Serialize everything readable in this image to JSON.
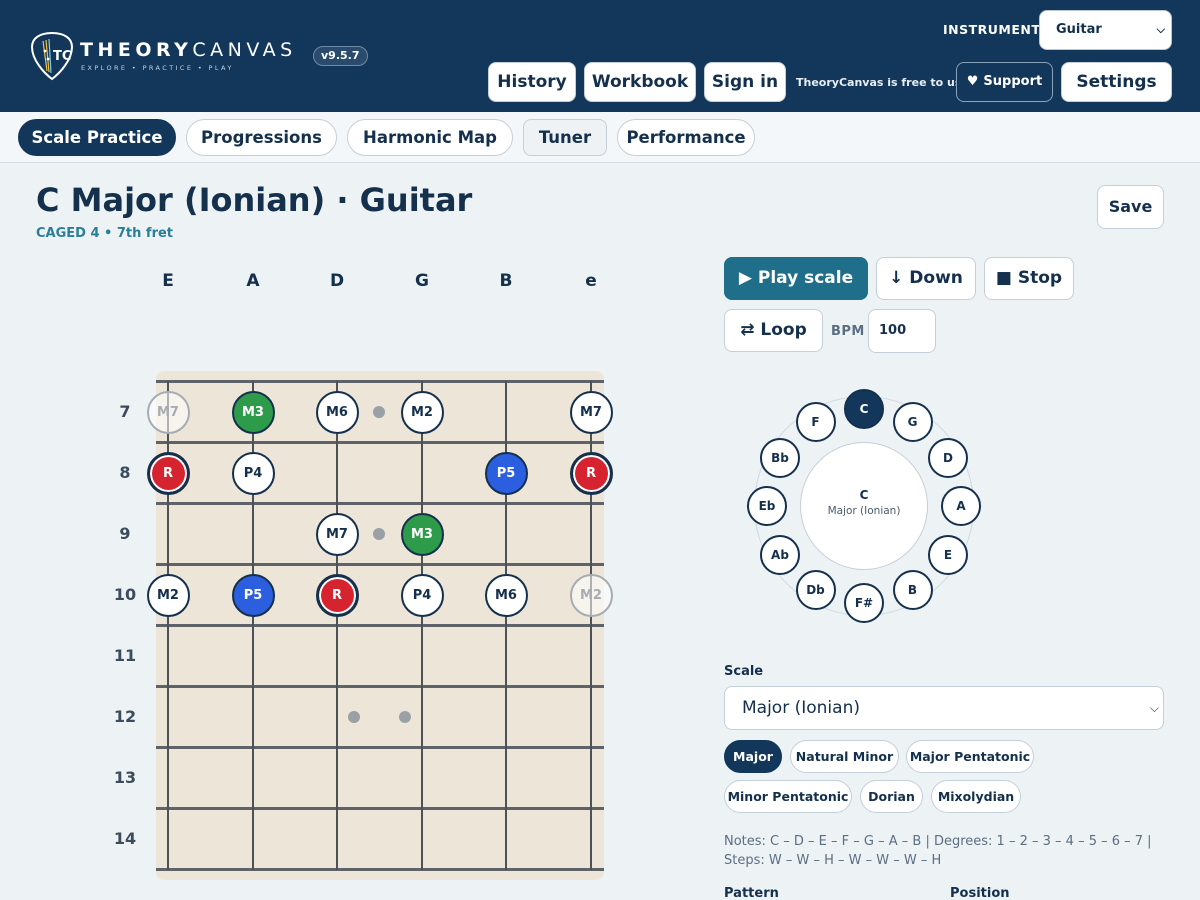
{
  "header": {
    "brand_bold": "THEORY",
    "brand_light": "CANVAS",
    "tagline": "EXPLORE • PRACTICE • PLAY",
    "logo_letters": "TC",
    "version": "v9.5.7",
    "instrument_label": "INSTRUMENT",
    "instrument_value": "Guitar",
    "nav": {
      "history": "History",
      "workbook": "Workbook",
      "sign_in": "Sign in"
    },
    "free_text": "TheoryCanvas is free to use.",
    "support": "Support",
    "settings": "Settings"
  },
  "tabs": [
    "Scale Practice",
    "Progressions",
    "Harmonic Map",
    "Tuner",
    "Performance"
  ],
  "active_tab": "Scale Practice",
  "page": {
    "title": "C Major (Ionian) · Guitar",
    "subtitle": "CAGED 4 • 7th fret",
    "save": "Save"
  },
  "fretboard": {
    "strings": [
      "E",
      "A",
      "D",
      "G",
      "B",
      "e"
    ],
    "frets": [
      "7",
      "8",
      "9",
      "10",
      "11",
      "12",
      "13",
      "14"
    ],
    "notes": [
      {
        "fret": 7,
        "string": 0,
        "label": "M7",
        "style": "faded"
      },
      {
        "fret": 7,
        "string": 1,
        "label": "M3",
        "style": "green"
      },
      {
        "fret": 7,
        "string": 2,
        "label": "M6",
        "style": "plain"
      },
      {
        "fret": 7,
        "string": 3,
        "label": "M2",
        "style": "plain"
      },
      {
        "fret": 7,
        "string": 5,
        "label": "M7",
        "style": "plain"
      },
      {
        "fret": 8,
        "string": 0,
        "label": "R",
        "style": "red"
      },
      {
        "fret": 8,
        "string": 1,
        "label": "P4",
        "style": "plain"
      },
      {
        "fret": 8,
        "string": 4,
        "label": "P5",
        "style": "blue"
      },
      {
        "fret": 8,
        "string": 5,
        "label": "R",
        "style": "red"
      },
      {
        "fret": 9,
        "string": 2,
        "label": "M7",
        "style": "plain"
      },
      {
        "fret": 9,
        "string": 3,
        "label": "M3",
        "style": "green"
      },
      {
        "fret": 10,
        "string": 0,
        "label": "M2",
        "style": "plain"
      },
      {
        "fret": 10,
        "string": 1,
        "label": "P5",
        "style": "blue"
      },
      {
        "fret": 10,
        "string": 2,
        "label": "R",
        "style": "red"
      },
      {
        "fret": 10,
        "string": 3,
        "label": "P4",
        "style": "plain"
      },
      {
        "fret": 10,
        "string": 4,
        "label": "M6",
        "style": "plain"
      },
      {
        "fret": 10,
        "string": 5,
        "label": "M2",
        "style": "faded"
      }
    ]
  },
  "controls": {
    "play": "Play scale",
    "down": "Down",
    "stop": "Stop",
    "loop": "Loop",
    "bpm_label": "BPM",
    "bpm_value": "100"
  },
  "circle": {
    "keys": [
      "C",
      "G",
      "D",
      "A",
      "E",
      "B",
      "F#",
      "Db",
      "Ab",
      "Eb",
      "Bb",
      "F"
    ],
    "active": "C",
    "center_key": "C",
    "center_mode": "Major (Ionian)"
  },
  "scale": {
    "label": "Scale",
    "selected": "Major (Ionian)",
    "chips": [
      "Major",
      "Natural Minor",
      "Major Pentatonic",
      "Minor Pentatonic",
      "Dorian",
      "Mixolydian"
    ],
    "active_chip": "Major",
    "notes_text": "Notes: C – D – E – F – G – A – B | Degrees: 1 – 2 – 3 – 4 – 5 – 6 – 7 | Steps: W – W – H – W – W – W – H",
    "pattern_label": "Pattern",
    "position_label": "Position"
  },
  "colors": {
    "navy": "#12375a",
    "teal": "#1f6f8b",
    "root_red": "#d5242f",
    "third_green": "#2e9b4b",
    "fifth_blue": "#2c5fe0",
    "fretboard": "#ede6d8"
  }
}
